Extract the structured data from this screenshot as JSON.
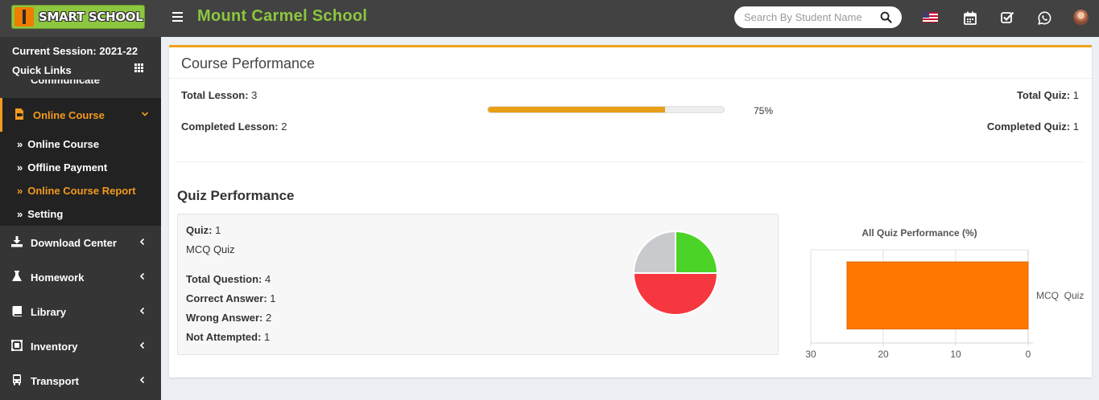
{
  "header": {
    "logo_text": "SMART SCHOOL",
    "school_name": "Mount Carmel School",
    "search_placeholder": "Search By Student Name"
  },
  "sidebar": {
    "session": "Current Session: 2021-22",
    "quick_links": "Quick Links",
    "peek_label": "Communicate",
    "items": [
      {
        "label": "Online Course",
        "icon": "video-file-icon",
        "active": true
      },
      {
        "label": "Download Center",
        "icon": "download-icon"
      },
      {
        "label": "Homework",
        "icon": "flask-icon"
      },
      {
        "label": "Library",
        "icon": "book-icon"
      },
      {
        "label": "Inventory",
        "icon": "inventory-icon"
      },
      {
        "label": "Transport",
        "icon": "bus-icon"
      }
    ],
    "submenu": [
      {
        "label": "Online Course"
      },
      {
        "label": "Offline Payment"
      },
      {
        "label": "Online Course Report",
        "active": true
      },
      {
        "label": "Setting"
      }
    ]
  },
  "course": {
    "title": "Course Performance",
    "total_lesson_label": "Total Lesson:",
    "total_lesson_value": "3",
    "completed_lesson_label": "Completed Lesson:",
    "completed_lesson_value": "2",
    "total_quiz_label": "Total Quiz:",
    "total_quiz_value": "1",
    "completed_quiz_label": "Completed Quiz:",
    "completed_quiz_value": "1",
    "progress_percent": 75,
    "progress_text": "75%"
  },
  "quiz": {
    "section_title": "Quiz Performance",
    "quiz_label": "Quiz:",
    "quiz_value": "1",
    "quiz_name": "MCQ Quiz",
    "total_question_label": "Total Question:",
    "total_question_value": "4",
    "correct_label": "Correct Answer:",
    "correct_value": "1",
    "wrong_label": "Wrong Answer:",
    "wrong_value": "2",
    "not_attempted_label": "Not Attempted:",
    "not_attempted_value": "1"
  },
  "colors": {
    "correct": "#4cd327",
    "wrong": "#f6373f",
    "not_attempted": "#c9cacd",
    "bar": "#ff7700",
    "accent": "#f29a1f",
    "brand_green": "#8dc63f"
  },
  "chart_data": [
    {
      "type": "pie",
      "categories": [
        "Correct Answer",
        "Wrong Answer",
        "Not Attempted"
      ],
      "values": [
        1,
        2,
        1
      ]
    },
    {
      "type": "bar",
      "orientation": "horizontal",
      "title": "All Quiz Performance (%)",
      "categories": [
        "MCQ  Quiz"
      ],
      "values": [
        25
      ],
      "xlim": [
        0,
        30
      ],
      "x_reversed": true,
      "x_ticks": [
        "30",
        "20",
        "10",
        "0"
      ],
      "grid": true
    }
  ]
}
